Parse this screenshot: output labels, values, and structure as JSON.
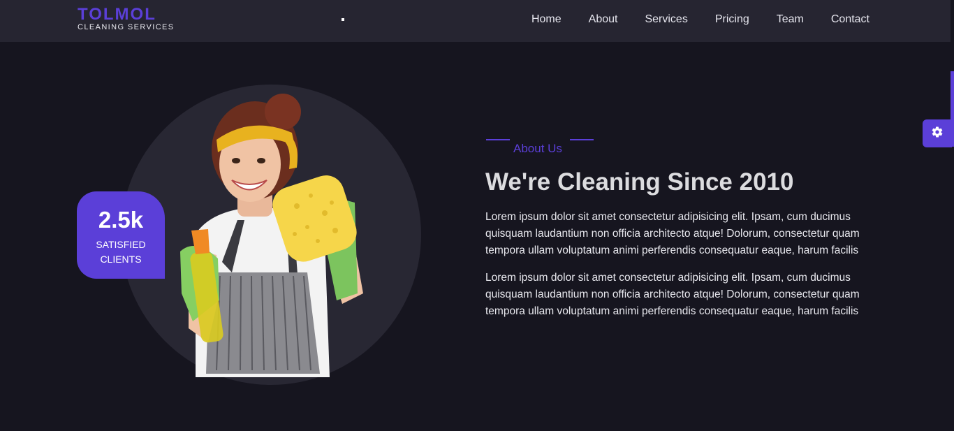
{
  "brand": {
    "name": "TOLMOL",
    "tagline": "CLEANING SERVICES"
  },
  "nav": {
    "items": [
      {
        "label": "Home"
      },
      {
        "label": "About"
      },
      {
        "label": "Services"
      },
      {
        "label": "Pricing"
      },
      {
        "label": "Team"
      },
      {
        "label": "Contact"
      }
    ]
  },
  "stat": {
    "number": "2.5k",
    "label": "SATISFIED CLIENTS"
  },
  "about": {
    "eyebrow": "About Us",
    "title": "We're Cleaning Since 2010",
    "paragraphs": [
      "Lorem ipsum dolor sit amet consectetur adipisicing elit. Ipsam, cum ducimus quisquam laudantium non officia architecto atque! Dolorum, consectetur quam tempora ullam voluptatum animi perferendis consequatur eaque, harum facilis",
      "Lorem ipsum dolor sit amet consectetur adipisicing elit. Ipsam, cum ducimus quisquam laudantium non officia architecto atque! Dolorum, consectetur quam tempora ullam voluptatum animi perferendis consequatur eaque, harum facilis"
    ]
  },
  "colors": {
    "accent": "#5b3fd8",
    "page_background": "#16151f",
    "navbar_background": "#262531",
    "circle_background": "#282733"
  },
  "icons": {
    "settings": "gear-icon",
    "hero_image": "cleaning-woman-illustration"
  }
}
